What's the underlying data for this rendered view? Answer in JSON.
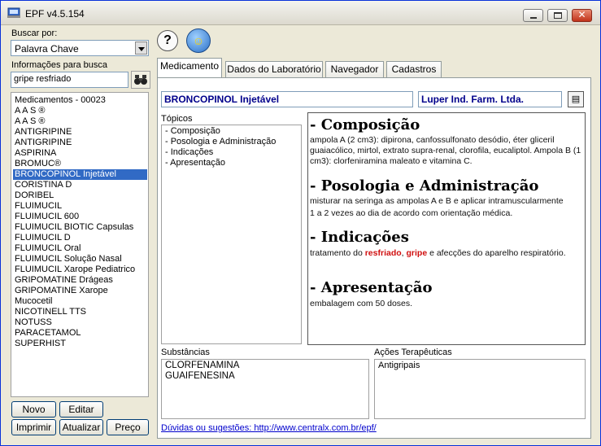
{
  "window": {
    "title": "EPF v4.5.154"
  },
  "search": {
    "buscar_label": "Buscar por:",
    "buscar_value": "Palavra Chave",
    "info_label": "Informações para busca",
    "info_value": "gripe resfriado",
    "search_icon": "binoculars-icon"
  },
  "medicamentos": {
    "header": "Medicamentos - 00023",
    "items": [
      "A A S ®",
      "A A S ®",
      "ANTIGRIPINE",
      "ANTIGRIPINE",
      "ASPIRINA",
      "BROMUC®",
      "BRONCOPINOL Injetável",
      "CORISTINA D",
      "DORIBEL",
      "FLUIMUCIL",
      "FLUIMUCIL 600",
      "FLUIMUCIL BIOTIC Capsulas",
      "FLUIMUCIL D",
      "FLUIMUCIL Oral",
      "FLUIMUCIL Solução Nasal",
      "FLUIMUCIL Xarope Pediatrico",
      "GRIPOMATINE Drágeas",
      "GRIPOMATINE Xarope",
      "Mucocetil",
      "NICOTINELL TTS",
      "NOTUSS",
      "PARACETAMOL",
      "SUPERHIST"
    ],
    "selected_index": 6
  },
  "buttons": {
    "novo": "Novo",
    "editar": "Editar",
    "imprimir": "Imprimir",
    "atualizar": "Atualizar",
    "preco": "Preço"
  },
  "toolbar": {
    "help": "?",
    "chat": "☺"
  },
  "tabs": [
    "Medicamento",
    "Dados do Laboratório",
    "Navegador",
    "Cadastros"
  ],
  "medicamento": {
    "name": "BRONCOPINOL Injetável",
    "lab": "Luper Ind. Farm. Ltda.",
    "topicos_label": "Tópicos",
    "topicos": [
      "- Composição",
      "- Posologia e Administração",
      "- Indicações",
      "- Apresentação"
    ],
    "sections": {
      "composicao_title": "- Composição",
      "composicao_body": "ampola A (2 cm3): dipirona, canfossulfonato desódio, éter gliceril guaiacólico, mirtol, extrato supra-renal, clorofila, eucaliptol. Ampola B (1 cm3): clorfeniramina maleato e vitamina C.",
      "posologia_title": "- Posologia e Administração",
      "posologia_line1": "misturar na seringa as ampolas A e B e aplicar intramuscularmente",
      "posologia_line2": "1 a 2 vezes ao dia de acordo com orientação médica.",
      "indicacoes_title": "- Indicações",
      "indicacoes_pre": "tratamento do ",
      "indicacoes_hl1": "resfriado",
      "indicacoes_sep": ", ",
      "indicacoes_hl2": "gripe",
      "indicacoes_post": " e afecções do aparelho respiratório.",
      "apresentacao_title": "- Apresentação",
      "apresentacao_body": "embalagem com 50 doses."
    },
    "substancias_label": "Substâncias",
    "substancias": [
      "CLORFENAMINA",
      "GUAIFENESINA"
    ],
    "acoes_label": "Ações Terapêuticas",
    "acoes": [
      "Antigripais"
    ],
    "link": "Dúvidas ou sugestões: http://www.centralx.com.br/epf/"
  }
}
